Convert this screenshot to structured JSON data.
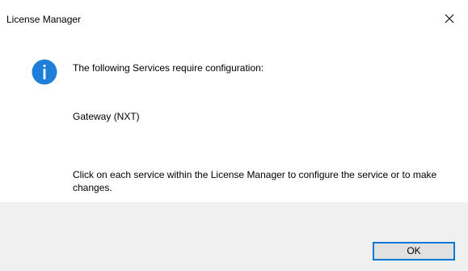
{
  "window": {
    "title": "License Manager",
    "close_icon": "close-icon"
  },
  "dialog": {
    "icon": "info-icon",
    "icon_color": "#1e7fd8",
    "heading": "The following Services require configuration:",
    "services": [
      "Gateway (NXT)"
    ],
    "instruction": "Click on each service within the License Manager to configure the service or to make changes."
  },
  "footer": {
    "ok_label": "OK",
    "background": "#f0f0f0",
    "focus_color": "#0078d7"
  }
}
